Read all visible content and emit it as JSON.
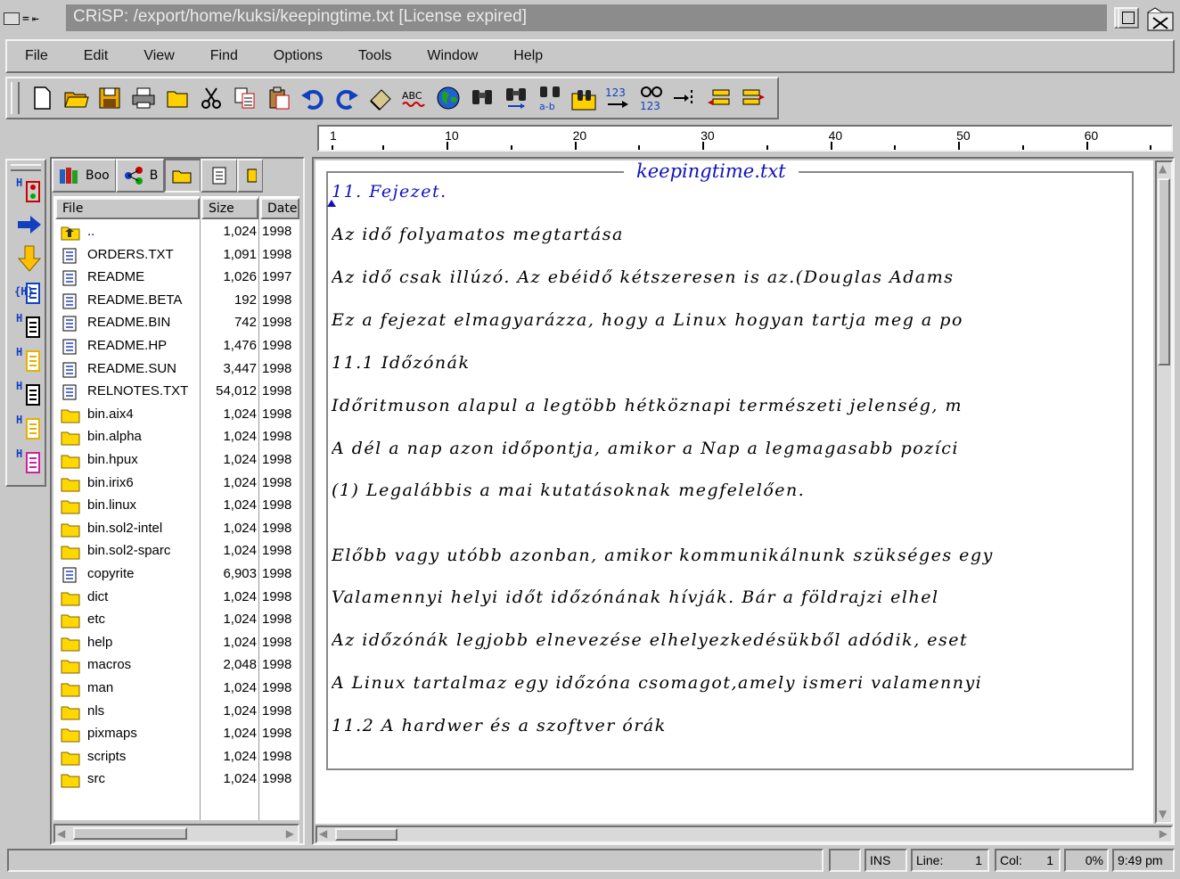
{
  "window": {
    "title": "CRiSP: /export/home/kuksi/keepingtime.txt [License expired]",
    "sysmenu_label": "="
  },
  "menubar": [
    "File",
    "Edit",
    "View",
    "Find",
    "Options",
    "Tools",
    "Window",
    "Help"
  ],
  "toolbar_icons": [
    "new-file-icon",
    "open-folder-icon",
    "save-icon",
    "print-icon",
    "folder-icon",
    "cut-icon",
    "copy-icon",
    "paste-icon",
    "undo-icon",
    "redo-icon",
    "eraser-icon",
    "spell-check-icon",
    "globe-icon",
    "find-icon",
    "find-next-icon",
    "find-replace-icon",
    "find-in-files-icon",
    "goto-line-icon",
    "compare-numbers-icon",
    "indent-icon",
    "outdent-icon",
    "reformat-icon"
  ],
  "spell_label": "ABC",
  "goto_label": "123",
  "compare_label": "123",
  "replace_label": "a-b",
  "browser": {
    "tabs": [
      {
        "label": "Boo",
        "icon": "books-icon"
      },
      {
        "label": "B",
        "icon": "tree-icon"
      },
      {
        "label": "",
        "icon": "folder-tab-icon"
      },
      {
        "label": "",
        "icon": "document-tab-icon"
      },
      {
        "label": "",
        "icon": "partial-tab-icon"
      }
    ],
    "columns": {
      "name": "File",
      "size": "Size",
      "date": "Date"
    },
    "files": [
      {
        "name": "..",
        "size": "1,024",
        "date": "1998",
        "type": "up"
      },
      {
        "name": "ORDERS.TXT",
        "size": "1,091",
        "date": "1998",
        "type": "file"
      },
      {
        "name": "README",
        "size": "1,026",
        "date": "1997",
        "type": "file"
      },
      {
        "name": "README.BETA",
        "size": "192",
        "date": "1998",
        "type": "file"
      },
      {
        "name": "README.BIN",
        "size": "742",
        "date": "1998",
        "type": "file"
      },
      {
        "name": "README.HP",
        "size": "1,476",
        "date": "1998",
        "type": "file"
      },
      {
        "name": "README.SUN",
        "size": "3,447",
        "date": "1998",
        "type": "file"
      },
      {
        "name": "RELNOTES.TXT",
        "size": "54,012",
        "date": "1998",
        "type": "file"
      },
      {
        "name": "bin.aix4",
        "size": "1,024",
        "date": "1998",
        "type": "folder"
      },
      {
        "name": "bin.alpha",
        "size": "1,024",
        "date": "1998",
        "type": "folder"
      },
      {
        "name": "bin.hpux",
        "size": "1,024",
        "date": "1998",
        "type": "folder"
      },
      {
        "name": "bin.irix6",
        "size": "1,024",
        "date": "1998",
        "type": "folder"
      },
      {
        "name": "bin.linux",
        "size": "1,024",
        "date": "1998",
        "type": "folder"
      },
      {
        "name": "bin.sol2-intel",
        "size": "1,024",
        "date": "1998",
        "type": "folder"
      },
      {
        "name": "bin.sol2-sparc",
        "size": "1,024",
        "date": "1998",
        "type": "folder"
      },
      {
        "name": "copyrite",
        "size": "6,903",
        "date": "1998",
        "type": "file"
      },
      {
        "name": "dict",
        "size": "1,024",
        "date": "1998",
        "type": "folder"
      },
      {
        "name": "etc",
        "size": "1,024",
        "date": "1998",
        "type": "folder"
      },
      {
        "name": "help",
        "size": "1,024",
        "date": "1998",
        "type": "folder"
      },
      {
        "name": "macros",
        "size": "2,048",
        "date": "1998",
        "type": "folder"
      },
      {
        "name": "man",
        "size": "1,024",
        "date": "1998",
        "type": "folder"
      },
      {
        "name": "nls",
        "size": "1,024",
        "date": "1998",
        "type": "folder"
      },
      {
        "name": "pixmaps",
        "size": "1,024",
        "date": "1998",
        "type": "folder"
      },
      {
        "name": "scripts",
        "size": "1,024",
        "date": "1998",
        "type": "folder"
      },
      {
        "name": "src",
        "size": "1,024",
        "date": "1998",
        "type": "folder"
      }
    ]
  },
  "vstrip_icons": [
    "hypertext-traffic-icon",
    "arrow-right-icon",
    "arrow-down-icon",
    "hypertext-braces-icon",
    "hypertext-page-icon",
    "hypertext-list-icon",
    "hypertext-table-icon",
    "hypertext-doc-icon",
    "hypertext-pink-icon"
  ],
  "vstrip_labels": [
    "H",
    "",
    "",
    "{H}",
    "H",
    "H",
    "H",
    "H",
    "H"
  ],
  "ruler": {
    "labels": [
      "1",
      "10",
      "20",
      "30",
      "40",
      "50",
      "60"
    ]
  },
  "editor": {
    "filename": "keepingtime.txt",
    "lines": [
      {
        "text": "11. Fejezet.",
        "color": "#1010c0"
      },
      {
        "text": "Az idő folyamatos megtartása",
        "color": "#000000"
      },
      {
        "text": "Az idő csak illúzó. Az ebéidő kétszeresen is az.(Douglas Adams",
        "color": "#000000"
      },
      {
        "text": "Ez a fejezat elmagyarázza, hogy a Linux hogyan tartja meg a po",
        "color": "#000000"
      },
      {
        "text": "11.1 Időzónák",
        "color": "#000000"
      },
      {
        "text": "Időritmuson alapul a legtöbb hétköznapi természeti jelenség, m",
        "color": "#000000"
      },
      {
        "text": "A  dél a nap azon időpontja, amikor a Nap a legmagasabb pozíci",
        "color": "#000000"
      },
      {
        "text": "(1) Legalábbis a mai kutatásoknak megfelelően.",
        "color": "#000000"
      },
      {
        "text": "Előbb vagy utóbb azonban, amikor kommunikálnunk szükséges egy",
        "color": "#000000"
      },
      {
        "text": "Valamennyi helyi időt időzónának hívják. Bár a földrajzi elhel",
        "color": "#000000"
      },
      {
        "text": "Az időzónák legjobb elnevezése elhelyezkedésükből adódik, eset",
        "color": "#000000"
      },
      {
        "text": "A Linux tartalmaz egy időzóna csomagot,amely ismeri valamennyi",
        "color": "#000000"
      },
      {
        "text": "11.2 A hardwer és a szoftver órák",
        "color": "#000000"
      }
    ]
  },
  "status": {
    "mode": "INS",
    "line_label": "Line:",
    "line_value": "1",
    "col_label": "Col:",
    "col_value": "1",
    "percent": "0%",
    "time": "9:49 pm"
  }
}
